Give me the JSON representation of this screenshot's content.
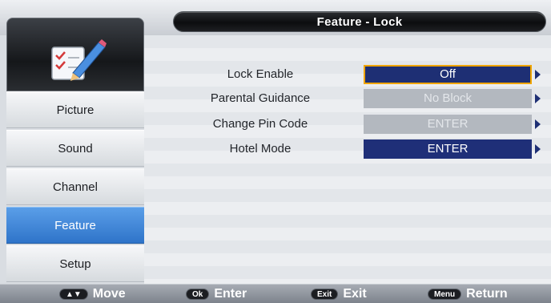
{
  "header": {
    "title": "Feature - Lock"
  },
  "sidebar": {
    "icon": "checklist-pencil-icon",
    "items": [
      {
        "label": "Picture",
        "active": false
      },
      {
        "label": "Sound",
        "active": false
      },
      {
        "label": "Channel",
        "active": false
      },
      {
        "label": "Feature",
        "active": true
      },
      {
        "label": "Setup",
        "active": false
      }
    ]
  },
  "settings": [
    {
      "label": "Lock Enable",
      "value": "Off",
      "state": "selected"
    },
    {
      "label": "Parental Guidance",
      "value": "No Block",
      "state": "disabled"
    },
    {
      "label": "Change Pin Code",
      "value": "ENTER",
      "state": "disabled"
    },
    {
      "label": "Hotel Mode",
      "value": "ENTER",
      "state": "normal"
    }
  ],
  "footer": {
    "hints": [
      {
        "badge": "▲▼",
        "label": "Move"
      },
      {
        "badge": "Ok",
        "label": "Enter"
      },
      {
        "badge": "Exit",
        "label": "Exit"
      },
      {
        "badge": "Menu",
        "label": "Return"
      }
    ]
  },
  "colors": {
    "active_nav": "#2f74c9",
    "selected_border": "#f0a500",
    "value_bg": "#1e2f74",
    "disabled_bg": "#b3b8bf"
  }
}
